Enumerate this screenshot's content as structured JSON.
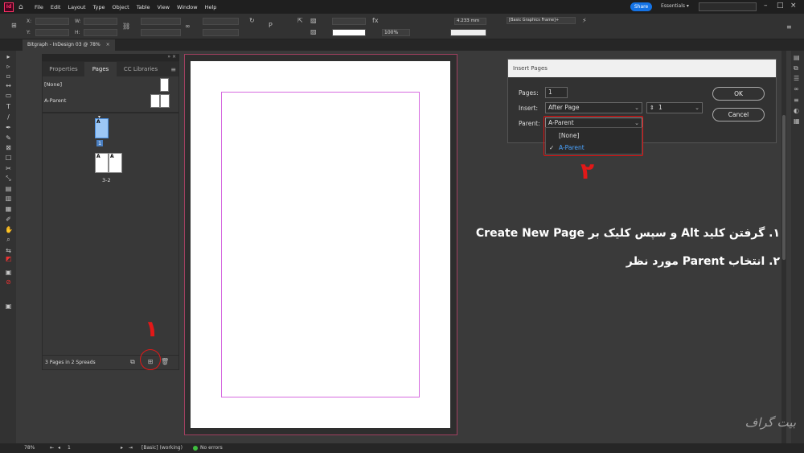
{
  "menubar": {
    "app_logo": "Id",
    "items": [
      "File",
      "Edit",
      "Layout",
      "Type",
      "Object",
      "Table",
      "View",
      "Window",
      "Help"
    ],
    "share_label": "Share",
    "workspace": "Essentials ▾"
  },
  "controlbar": {
    "x_label": "X:",
    "y_label": "Y:",
    "w_label": "W:",
    "h_label": "H:",
    "stroke_weight": "4.233 mm",
    "zoom": "100%",
    "frame_style": "[Basic Graphics Frame]+"
  },
  "document_tab": {
    "title": "Bitgraph - InDesign 03 @ 78%",
    "close": "×"
  },
  "pages_panel": {
    "tabs": [
      "Properties",
      "Pages",
      "CC Libraries"
    ],
    "parents": [
      {
        "label": "[None]"
      },
      {
        "label": "A-Parent"
      }
    ],
    "pages": [
      {
        "label": "1",
        "prefix": "A"
      },
      {
        "label": "3-2",
        "prefix_left": "A",
        "prefix_right": "A"
      }
    ],
    "footer_text": "3 Pages in 2 Spreads"
  },
  "insert_pages_dialog": {
    "title": "Insert Pages",
    "pages_label": "Pages:",
    "pages_value": "1",
    "insert_label": "Insert:",
    "insert_value": "After Page",
    "insert_page_number": "1",
    "parent_label": "Parent:",
    "parent_value": "A-Parent",
    "ok_label": "OK",
    "cancel_label": "Cancel",
    "dropdown_options": [
      {
        "label": "[None]",
        "selected": false
      },
      {
        "label": "A-Parent",
        "selected": true
      }
    ]
  },
  "annotations": {
    "number_1": "۱",
    "number_2": "۲",
    "step_1": "۱. گرفتن کلید Alt و سپس کلیک بر Create New Page",
    "step_2": "۲. انتخاب Parent مورد نظر",
    "color": "#e21818"
  },
  "statusbar": {
    "zoom": "78%",
    "page": "1",
    "profile": "[Basic] (working)",
    "status": "No errors"
  },
  "watermark": "بیت گراف"
}
